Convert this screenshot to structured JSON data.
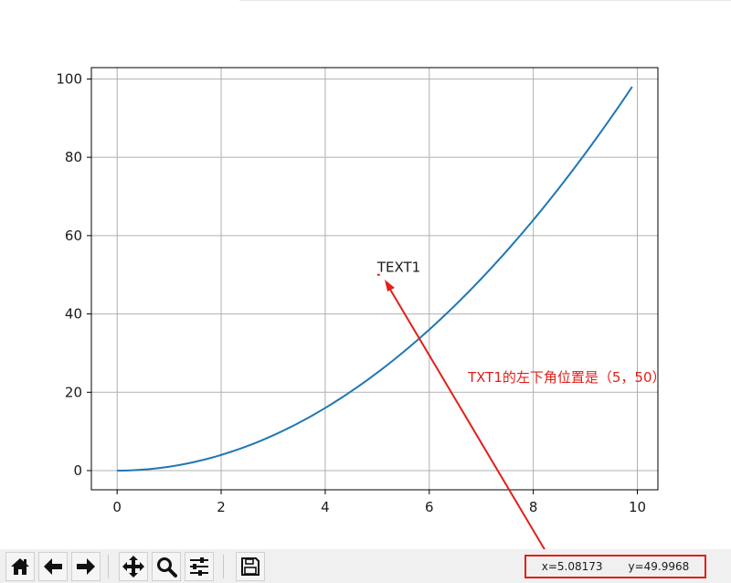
{
  "chart_data": {
    "type": "line",
    "title": "",
    "xlabel": "",
    "ylabel": "",
    "xlim": [
      -0.495,
      10.395
    ],
    "ylim": [
      -4.9,
      102.9
    ],
    "grid": true,
    "xticks": [
      "0",
      "2",
      "4",
      "6",
      "8",
      "10"
    ],
    "yticks": [
      "0",
      "20",
      "40",
      "60",
      "80",
      "100"
    ],
    "series": [
      {
        "color": "#1f77b4",
        "function": "y = x^2",
        "x_start": 0,
        "x_end": 9.9,
        "x_step": 0.1
      }
    ],
    "annotations": [
      {
        "text": "TEXT1",
        "x": 5,
        "y": 50,
        "marker_color": "#e0201a"
      }
    ]
  },
  "note": {
    "text": "TXT1的左下角位置是（5，50）",
    "color": "#e0201a"
  },
  "toolbar": {
    "buttons": [
      {
        "name": "home-button",
        "icon": "home-icon"
      },
      {
        "name": "back-button",
        "icon": "arrow-left-icon"
      },
      {
        "name": "forward-button",
        "icon": "arrow-right-icon"
      },
      {
        "name": "pan-button",
        "icon": "move-icon"
      },
      {
        "name": "zoom-button",
        "icon": "magnifier-icon"
      },
      {
        "name": "configure-subplots-button",
        "icon": "sliders-icon"
      },
      {
        "name": "save-button",
        "icon": "floppy-disk-icon"
      }
    ],
    "coords": {
      "x_text": "x=5.08173",
      "y_text": "y=49.9968"
    }
  }
}
